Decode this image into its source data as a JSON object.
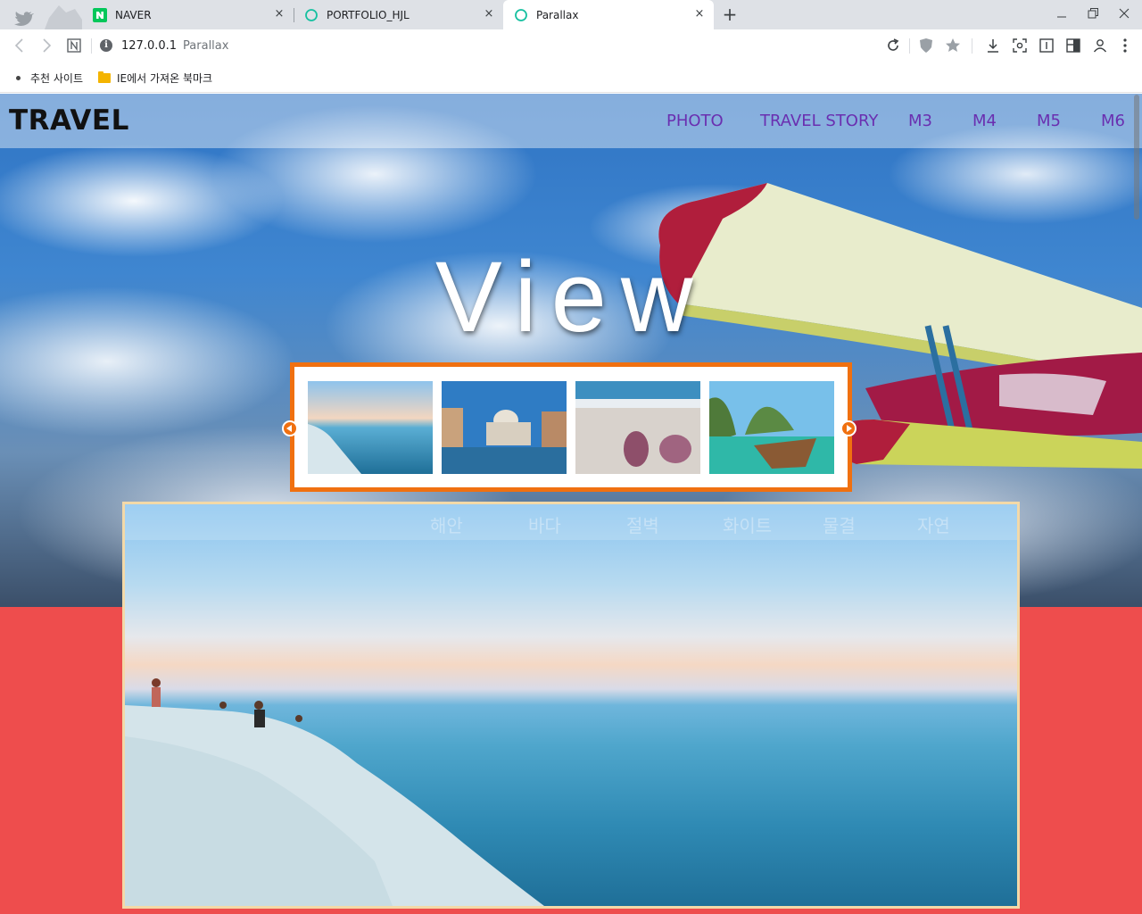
{
  "browser": {
    "tabs": [
      {
        "label": "NAVER",
        "close": "×"
      },
      {
        "label": "PORTFOLIO_HJL",
        "close": "×"
      },
      {
        "label": "Parallax",
        "close": "×"
      }
    ],
    "new_tab": "+",
    "window_controls": {
      "minimize": "—",
      "restore": "❐",
      "close": "✕"
    },
    "address": {
      "host": "127.0.0.1",
      "page_title": "Parallax",
      "info_glyph": "i"
    },
    "bookmarks": [
      {
        "label": "추천 사이트"
      },
      {
        "label": "IE에서 가져온 북마크"
      }
    ]
  },
  "site": {
    "logo": "TRAVEL",
    "menu": [
      "PHOTO",
      "TRAVEL STORY",
      "M3",
      "M4",
      "M5",
      "M6"
    ],
    "menu_color": "#6a2fb0",
    "hero_title": "View",
    "slider_border_color": "#f07010",
    "thumbnails": [
      "coast-cliff-sea",
      "venice-canal",
      "seashells-beach",
      "longtail-boat-lagoon"
    ],
    "captions": [
      "해안",
      "바다",
      "절벽",
      "화이트",
      "물결",
      "자연"
    ],
    "lower_background": "#ee4d4d"
  }
}
